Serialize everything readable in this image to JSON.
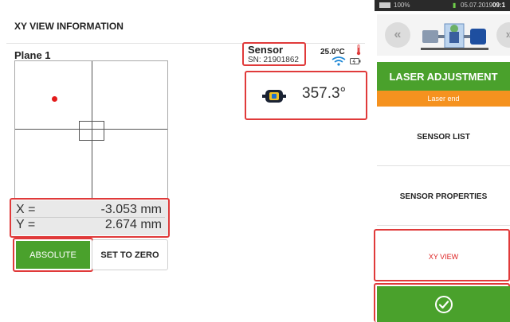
{
  "header": {
    "title": "XY VIEW INFORMATION"
  },
  "plot": {
    "plane_label": "Plane 1",
    "marker_color": "#e31b1b"
  },
  "readout": {
    "x_label": "X =",
    "x_value": "-3.053 mm",
    "y_label": "Y =",
    "y_value": "2.674 mm"
  },
  "buttons": {
    "absolute_label": "ABSOLUTE",
    "set_to_zero_label": "SET TO ZERO"
  },
  "sensor": {
    "title": "Sensor",
    "serial": "SN: 21901862",
    "temperature": "25.0°C",
    "angle": "357.3°",
    "icons": [
      "thermometer-icon",
      "wifi-icon",
      "battery-icon",
      "laser-sensor-icon"
    ]
  },
  "statusbar": {
    "battery_pct": "100%",
    "date": "05.07.2019",
    "time": "09:1"
  },
  "sidebar": {
    "laser_adjustment": "LASER ADJUSTMENT",
    "laser_end": "Laser end",
    "items": [
      {
        "label": "SENSOR LIST"
      },
      {
        "label": "SENSOR PROPERTIES"
      },
      {
        "label": "XY VIEW"
      }
    ],
    "confirm_icon": "checkmark-circle-icon"
  },
  "colors": {
    "accent_green": "#4aa12c",
    "accent_orange": "#f5921f",
    "highlight_red": "#e03a3a"
  }
}
